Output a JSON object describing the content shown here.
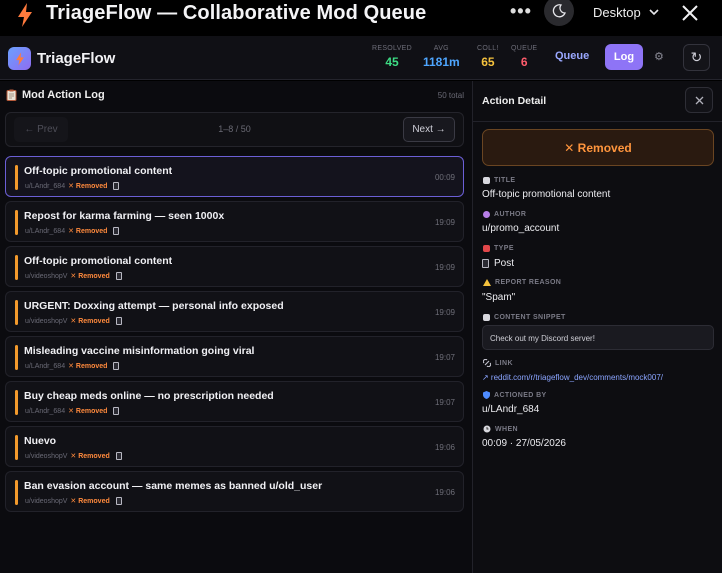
{
  "window": {
    "title": "TriageFlow — Collaborative Mod Queue",
    "more": "•••",
    "device": "Desktop"
  },
  "header": {
    "brand": "TriageFlow",
    "stats": [
      {
        "label": "RESOLVED",
        "value": "45",
        "color": "#3ddc84"
      },
      {
        "label": "AVG",
        "value": "1181m",
        "color": "#4ea6ff"
      },
      {
        "label": "COLL!",
        "value": "65",
        "color": "#f5c23d"
      },
      {
        "label": "QUEUE",
        "value": "6",
        "color": "#ff5c6c"
      }
    ],
    "queue_label": "Queue",
    "log_label": "Log",
    "settings_glyph": "⚙",
    "refresh_glyph": "↻"
  },
  "log": {
    "title": "Mod Action Log",
    "total": "50 total",
    "prev": "← Prev",
    "range": "1–8 / 50",
    "next": "Next →",
    "rows": [
      {
        "title": "Off-topic promotional content",
        "user": "u/LAndr_684",
        "status": "✕ Removed",
        "time": "00:09"
      },
      {
        "title": "Repost for karma farming — seen 1000x",
        "user": "u/LAndr_684",
        "status": "✕ Removed",
        "time": "19:09"
      },
      {
        "title": "Off-topic promotional content",
        "user": "u/videoshopV",
        "status": "✕ Removed",
        "time": "19:09"
      },
      {
        "title": "URGENT: Doxxing attempt — personal info exposed",
        "user": "u/videoshopV",
        "status": "✕ Removed",
        "time": "19:09"
      },
      {
        "title": "Misleading vaccine misinformation going viral",
        "user": "u/LAndr_684",
        "status": "✕ Removed",
        "time": "19:07"
      },
      {
        "title": "Buy cheap meds online — no prescription needed",
        "user": "u/LAndr_684",
        "status": "✕ Removed",
        "time": "19:07"
      },
      {
        "title": "Nuevo",
        "user": "u/videoshopV",
        "status": "✕ Removed",
        "time": "19:06"
      },
      {
        "title": "Ban evasion account — same memes as banned u/old_user",
        "user": "u/videoshopV",
        "status": "✕ Removed",
        "time": "19:06"
      }
    ]
  },
  "detail": {
    "title": "Action Detail",
    "status": "✕ Removed",
    "fields": {
      "title_label": "TITLE",
      "title_value": "Off-topic promotional content",
      "author_label": "AUTHOR",
      "author_value": "u/promo_account",
      "type_label": "TYPE",
      "type_value": "Post",
      "reason_label": "REPORT REASON",
      "reason_value": "\"Spam\"",
      "snippet_label": "CONTENT SNIPPET",
      "snippet_value": "Check out my Discord server!",
      "link_label": "LINK",
      "link_value": "↗ reddit.com/r/triageflow_dev/comments/mock007/",
      "actioned_label": "ACTIONED BY",
      "actioned_value": "u/LAndr_684",
      "when_label": "WHEN",
      "when_value": "00:09 · 27/05/2026"
    }
  }
}
